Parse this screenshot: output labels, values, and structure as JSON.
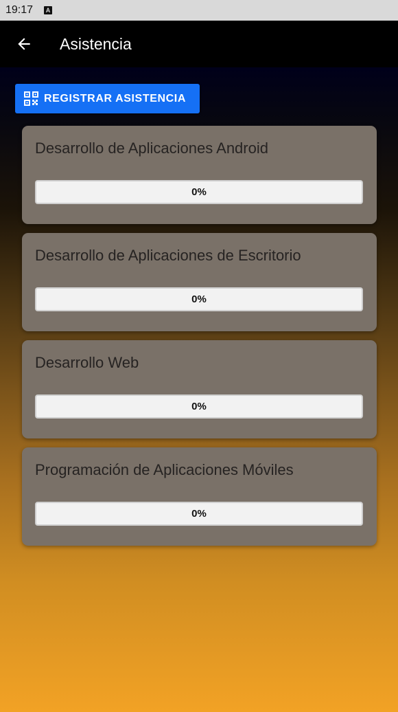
{
  "status_bar": {
    "time": "19:17",
    "notification_icon": "A"
  },
  "app_bar": {
    "title": "Asistencia",
    "back_icon": "arrow-left-icon"
  },
  "register_button": {
    "label": "REGISTRAR ASISTENCIA",
    "icon": "qr-code-icon"
  },
  "courses": [
    {
      "name": "Desarrollo de Aplicaciones Android",
      "progress_label": "0%",
      "progress": 0
    },
    {
      "name": "Desarrollo de Aplicaciones de Escritorio",
      "progress_label": "0%",
      "progress": 0
    },
    {
      "name": "Desarrollo Web",
      "progress_label": "0%",
      "progress": 0
    },
    {
      "name": "Programación de Aplicaciones Móviles",
      "progress_label": "0%",
      "progress": 0
    }
  ],
  "colors": {
    "accent": "#1570f5",
    "card": "#7a7168",
    "app_bar": "#000000"
  }
}
